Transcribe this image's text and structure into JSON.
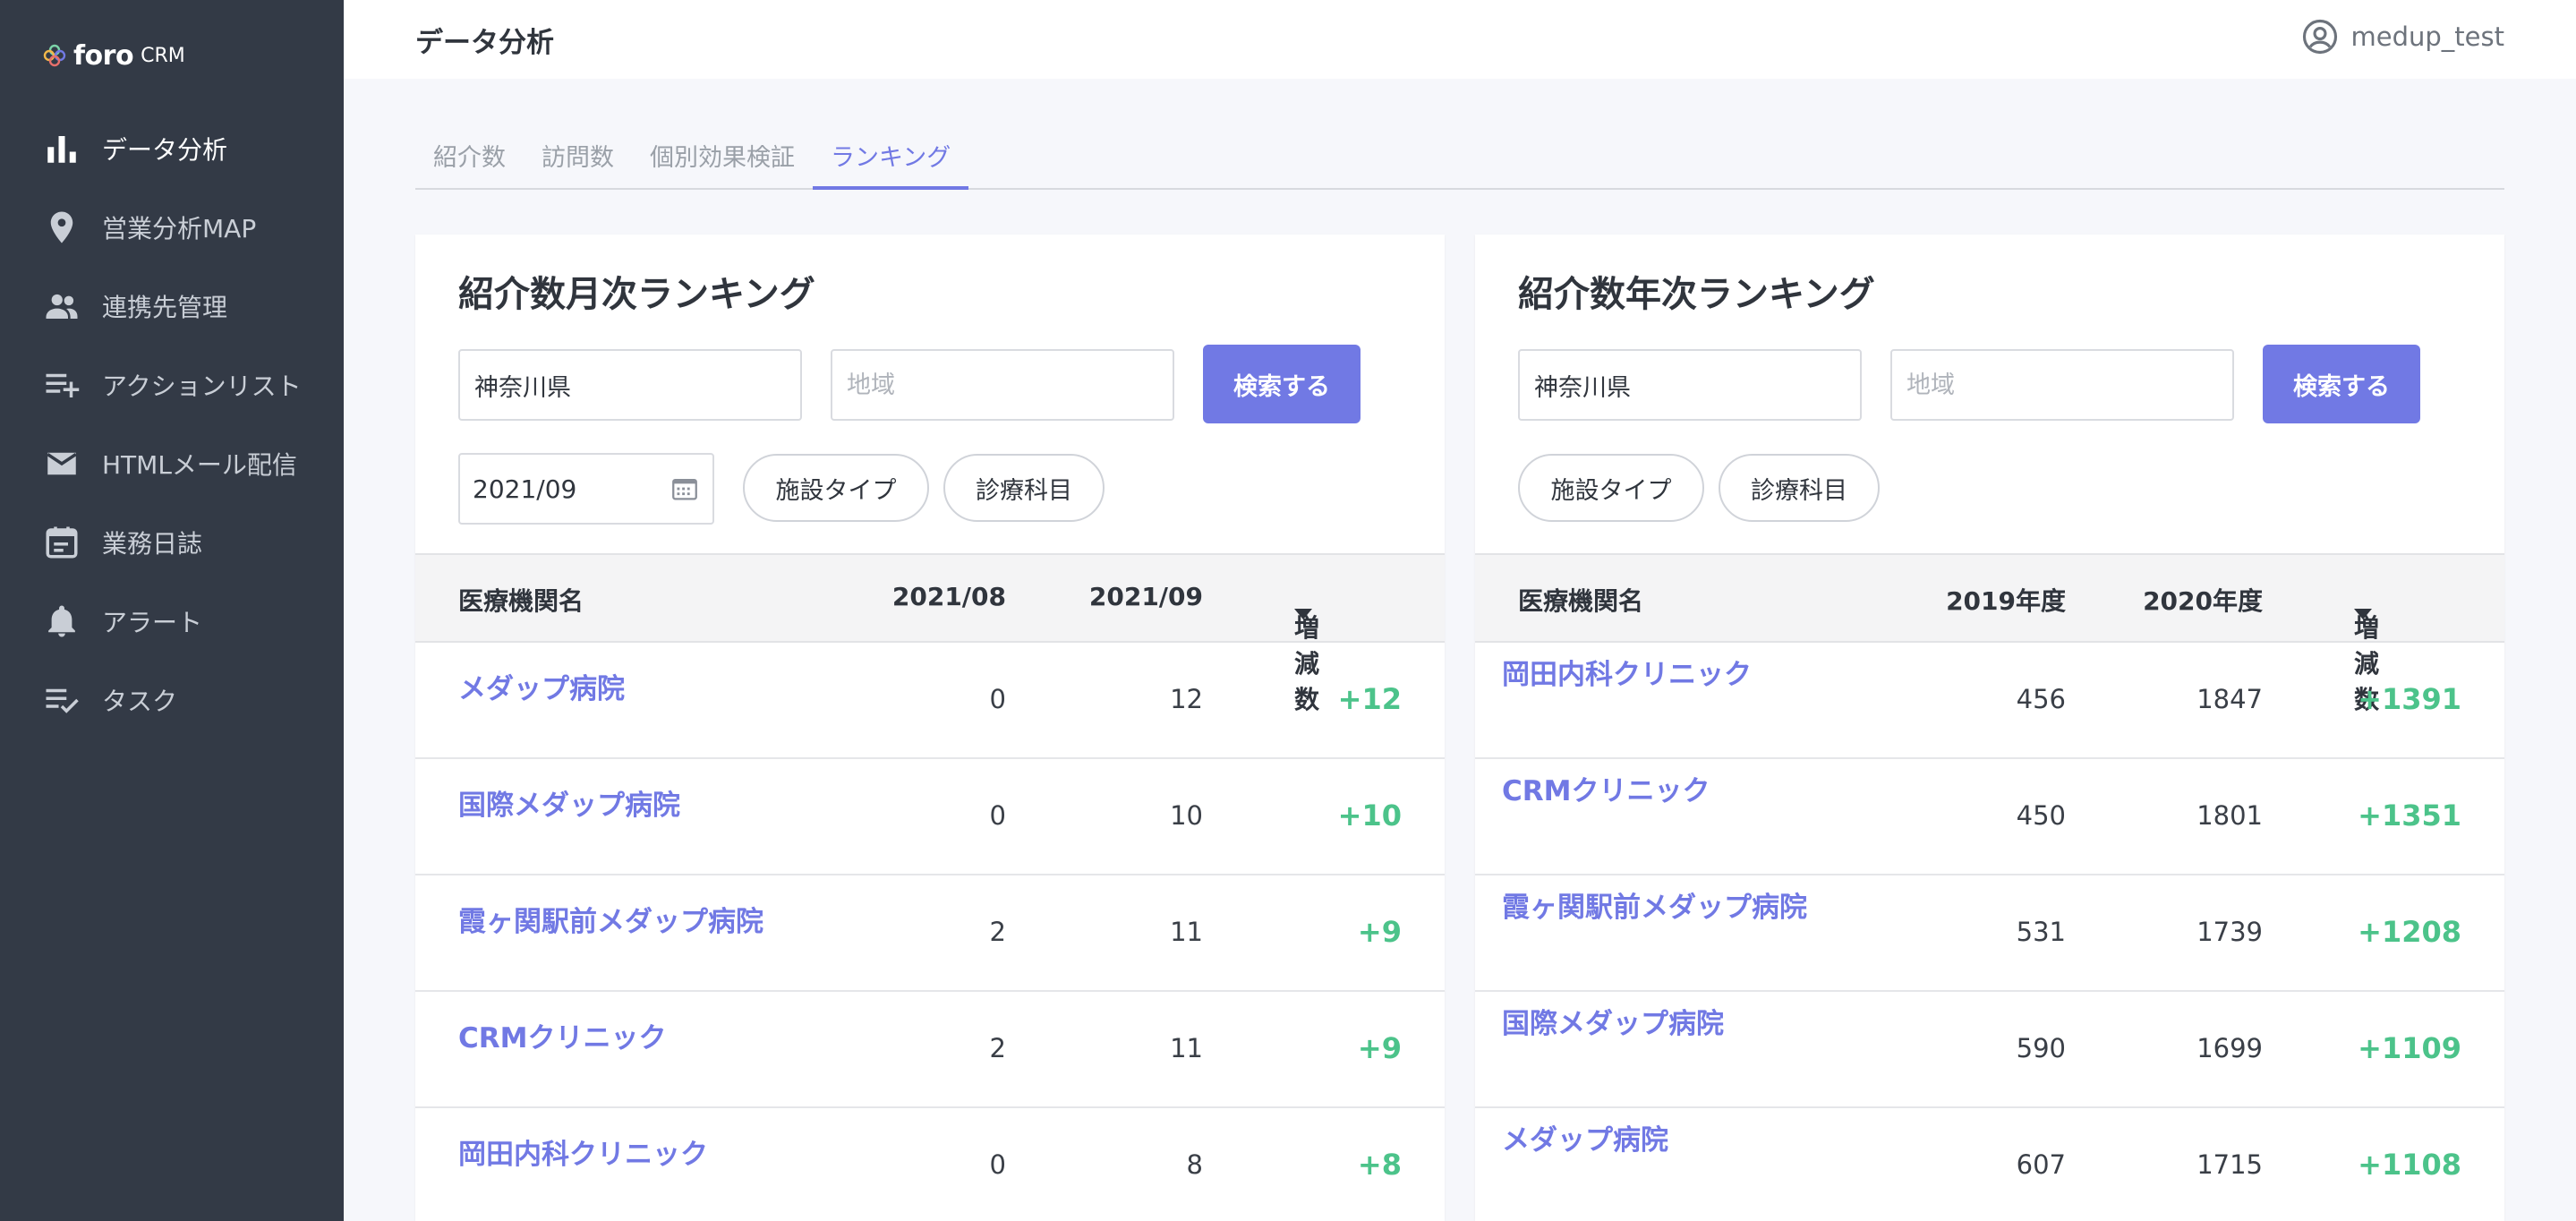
{
  "app": {
    "logo_text": "foro",
    "logo_sub": "CRM"
  },
  "sidebar": {
    "items": [
      {
        "label": "データ分析",
        "icon": "bar-chart-icon"
      },
      {
        "label": "営業分析MAP",
        "icon": "map-pin-icon"
      },
      {
        "label": "連携先管理",
        "icon": "people-icon"
      },
      {
        "label": "アクションリスト",
        "icon": "playlist-add-icon"
      },
      {
        "label": "HTMLメール配信",
        "icon": "mail-icon"
      },
      {
        "label": "業務日誌",
        "icon": "calendar-icon"
      },
      {
        "label": "アラート",
        "icon": "bell-icon"
      },
      {
        "label": "タスク",
        "icon": "playlist-check-icon"
      }
    ]
  },
  "header": {
    "title": "データ分析",
    "user": "medup_test"
  },
  "tabs": [
    {
      "label": "紹介数"
    },
    {
      "label": "訪問数"
    },
    {
      "label": "個別効果検証"
    },
    {
      "label": "ランキング"
    }
  ],
  "monthly": {
    "title": "紹介数月次ランキング",
    "prefecture_value": "神奈川県",
    "region_placeholder": "地域",
    "search_label": "検索する",
    "date_value": "2021/09",
    "filter_facility": "施設タイプ",
    "filter_department": "診療科目",
    "columns": {
      "name": "医療機関名",
      "c1": "2021/08",
      "c2": "2021/09",
      "diff": "増減数"
    },
    "rows": [
      {
        "name": "メダップ病院",
        "c1": "0",
        "c2": "12",
        "diff": "+12"
      },
      {
        "name": "国際メダップ病院",
        "c1": "0",
        "c2": "10",
        "diff": "+10"
      },
      {
        "name": "霞ヶ関駅前メダップ病院",
        "c1": "2",
        "c2": "11",
        "diff": "+9"
      },
      {
        "name": "CRMクリニック",
        "c1": "2",
        "c2": "11",
        "diff": "+9"
      },
      {
        "name": "岡田内科クリニック",
        "c1": "0",
        "c2": "8",
        "diff": "+8"
      }
    ]
  },
  "yearly": {
    "title": "紹介数年次ランキング",
    "prefecture_value": "神奈川県",
    "region_placeholder": "地域",
    "search_label": "検索する",
    "filter_facility": "施設タイプ",
    "filter_department": "診療科目",
    "columns": {
      "name": "医療機関名",
      "c1": "2019年度",
      "c2": "2020年度",
      "diff": "増減数"
    },
    "rows": [
      {
        "name": "岡田内科クリニック",
        "c1": "456",
        "c2": "1847",
        "diff": "+1391"
      },
      {
        "name": "CRMクリニック",
        "c1": "450",
        "c2": "1801",
        "diff": "+1351"
      },
      {
        "name": "霞ヶ関駅前メダップ病院",
        "c1": "531",
        "c2": "1739",
        "diff": "+1208"
      },
      {
        "name": "国際メダップ病院",
        "c1": "590",
        "c2": "1699",
        "diff": "+1109"
      },
      {
        "name": "メダップ病院",
        "c1": "607",
        "c2": "1715",
        "diff": "+1108"
      }
    ]
  },
  "colors": {
    "accent": "#7179e4",
    "sidebar": "#333a46",
    "positive": "#4cc38a"
  }
}
